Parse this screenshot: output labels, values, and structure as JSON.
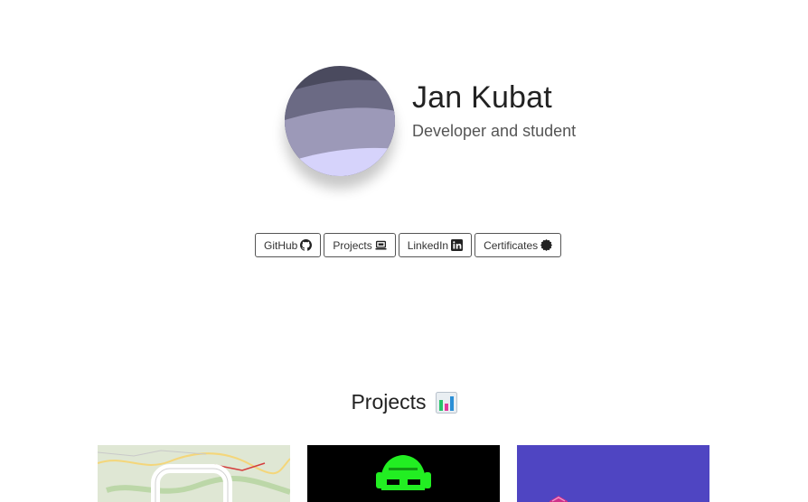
{
  "profile": {
    "name": "Jan Kubat",
    "tagline": "Developer and student"
  },
  "buttons": [
    {
      "label": "GitHub",
      "icon": "github-icon"
    },
    {
      "label": "Projects",
      "icon": "laptop-icon"
    },
    {
      "label": "LinkedIn",
      "icon": "linkedin-icon"
    },
    {
      "label": "Certificates",
      "icon": "badge-icon"
    }
  ],
  "projects": {
    "title": "Projects",
    "title_icon": "bar-chart-icon",
    "cards": [
      {
        "thumbnail": "map-thumbnail"
      },
      {
        "thumbnail": "green-skull-thumbnail"
      },
      {
        "thumbnail": "purple-logo-thumbnail"
      }
    ]
  },
  "colors": {
    "avatar_bands": [
      "#4a4a5e",
      "#6b6a84",
      "#9c99b8",
      "#d6d3fb"
    ],
    "card_2_bg": "#000000",
    "card_3_bg": "#4f45c2",
    "skull_green": "#22ee22"
  }
}
